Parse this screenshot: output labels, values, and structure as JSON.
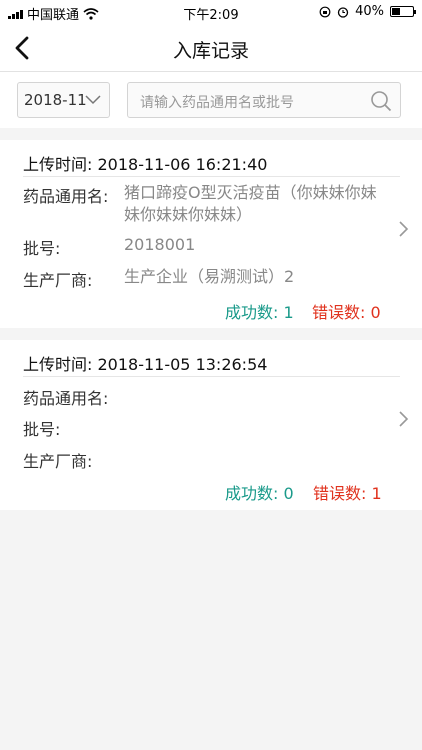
{
  "status_bar": {
    "carrier": "中国联通",
    "time": "下午2:09",
    "battery": "40%",
    "battery_level": 0.4
  },
  "nav": {
    "title": "入库记录",
    "back_icon": "chevron-left-icon"
  },
  "filter": {
    "month": "2018-11",
    "search_placeholder": "请输入药品通用名或批号",
    "search_icon": "search-icon"
  },
  "labels": {
    "upload_time": "上传时间:",
    "drug_name": "药品通用名:",
    "batch_no": "批号:",
    "manufacturer": "生产厂商:",
    "success": "成功数:",
    "error": "错误数:"
  },
  "records": [
    {
      "upload_time": "2018-11-06 16:21:40",
      "drug_name": "猪口蹄疫O型灭活疫苗（你妹妹你妹妹你妹妹你妹妹）",
      "batch_no": "2018001",
      "manufacturer": "生产企业（易溯测试）2",
      "success_count": "1",
      "error_count": "0"
    },
    {
      "upload_time": "2018-11-05 13:26:54",
      "drug_name": "",
      "batch_no": "",
      "manufacturer": "",
      "success_count": "0",
      "error_count": "1"
    }
  ],
  "colors": {
    "success": "#1a9a8a",
    "error": "#e0321e"
  }
}
